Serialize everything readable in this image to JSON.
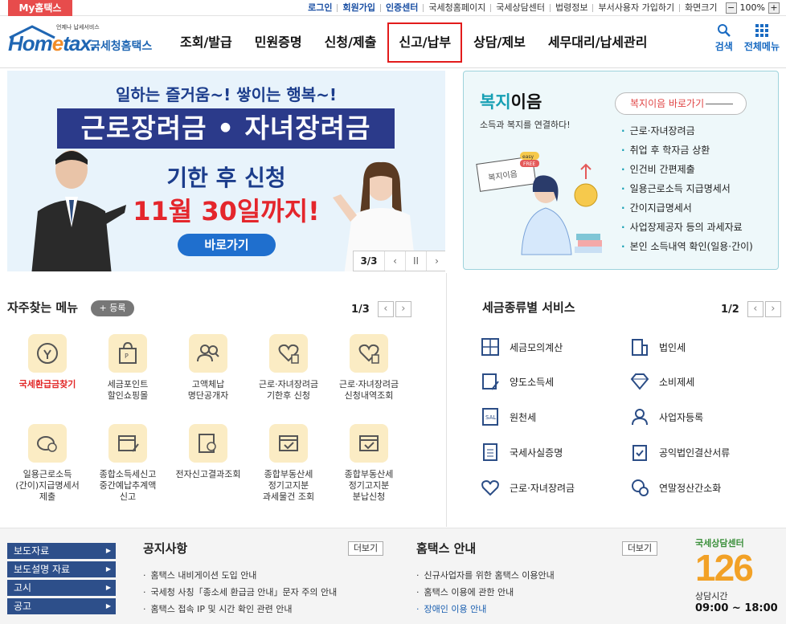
{
  "util": {
    "my_badge": "My홈택스",
    "links": [
      "로그인",
      "회원가입",
      "인증센터",
      "국세청홈페이지",
      "국세상담센터",
      "법령정보",
      "부서사용자 가입하기",
      "화면크기"
    ],
    "zoom_minus": "−",
    "zoom_value": "100%",
    "zoom_plus": "+"
  },
  "header": {
    "logo_small": "언제나 납세서비스",
    "logo_main_a": "Hom",
    "logo_main_e": "e",
    "logo_main_b": "tax.",
    "logo_kor": "국세청홈택스",
    "nav": [
      "조회/발급",
      "민원증명",
      "신청/제출",
      "신고/납부",
      "상담/제보",
      "세무대리/납세관리"
    ],
    "search_label": "검색",
    "allmenu_label": "전체메뉴"
  },
  "banner": {
    "top": "일하는 즐거움~! 쌓이는 행복~!",
    "bar": "근로장려금 • 자녀장려금",
    "line1": "기한 후 신청",
    "line2": "11월 30일까지!",
    "go": "바로가기",
    "page": "3/3",
    "prev": "‹",
    "pause": "II",
    "next": "›"
  },
  "welfare": {
    "title_a": "복지",
    "title_b": "이음",
    "subtitle": "소득과 복지를 연결하다!",
    "button": "복지이음 바로가기",
    "list": [
      "근로·자녀장려금",
      "취업 후 학자금 상환",
      "인건비 간편제출",
      "일용근로소득 지급명세서",
      "간이지급명세서",
      "사업장제공자 등의 과세자료",
      "본인 소득내역 확인(일용·간이)"
    ],
    "sign": "복지이음",
    "tag1": "easy",
    "tag2": "FREE"
  },
  "quick": {
    "title": "자주찾는 메뉴",
    "add": "+ 등록",
    "page": "1/3",
    "items": [
      {
        "label": "국세환급금찾기",
        "icon": "refund-icon"
      },
      {
        "label": "세금포인트\n할인쇼핑몰",
        "icon": "shopping-bag-icon"
      },
      {
        "label": "고액체납\n명단공개자",
        "icon": "people-search-icon"
      },
      {
        "label": "근로·자녀장려금\n기한후 신청",
        "icon": "heart-doc-icon"
      },
      {
        "label": "근로·자녀장려금\n신청내역조회",
        "icon": "heart-doc-icon"
      },
      {
        "label": "일용근로소득\n(간이)지급명세서\n제출",
        "icon": "wallet-icon"
      },
      {
        "label": "종합소득세신고\n중간예납추계액\n신고",
        "icon": "calendar-edit-icon"
      },
      {
        "label": "전자신고결과조회",
        "icon": "search-doc-icon"
      },
      {
        "label": "종합부동산세\n정기고지분\n과세물건 조회",
        "icon": "calendar-check-icon"
      },
      {
        "label": "종합부동산세\n정기고지분\n분납신청",
        "icon": "calendar-check-icon"
      }
    ]
  },
  "tax": {
    "title": "세금종류별 서비스",
    "page": "1/2",
    "left": [
      "세금모의계산",
      "양도소득세",
      "원천세",
      "국세사실증명",
      "근로·자녀장려금"
    ],
    "right": [
      "법인세",
      "소비제세",
      "사업자등록",
      "공익법인결산서류",
      "연말정산간소화"
    ]
  },
  "footer": {
    "links": [
      "보도자료",
      "보도설명 자료",
      "고시",
      "공고"
    ],
    "notice_title": "공지사항",
    "more": "더보기",
    "notice": [
      "홈택스 내비게이션 도입 안내",
      "국세청 사칭「종소세 환급금 안내」문자 주의 안내",
      "홈택스 접속 IP 및 시간 확인 관련 안내"
    ],
    "guide_title": "홈택스 안내",
    "guide": [
      "신규사업자를 위한 홈택스 이용안내",
      "홈택스 이용에 관한 안내",
      "장애인 이용 안내"
    ],
    "cc_label": "국세상담센터",
    "cc_num_a": "1",
    "cc_num_b": "2",
    "cc_num_c": "6",
    "cc_hours_label": "상담시간",
    "cc_hours": "09:00 ~ 18:00"
  }
}
